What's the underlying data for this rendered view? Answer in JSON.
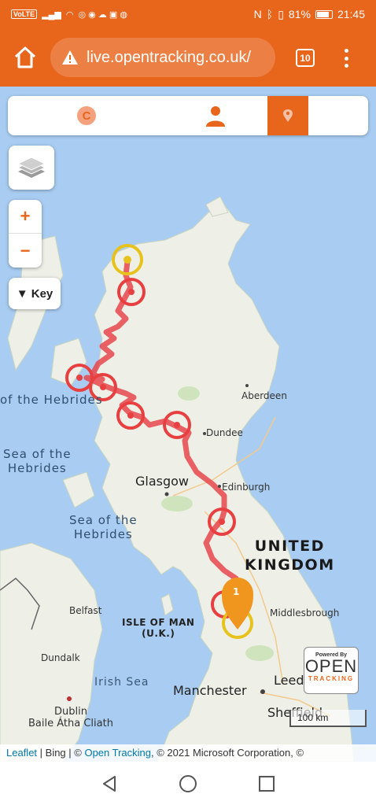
{
  "status_bar": {
    "volte": "VoLTE",
    "battery": "81%",
    "time": "21:45"
  },
  "browser": {
    "url": "live.opentracking.co.uk/",
    "tab_count": "10"
  },
  "panel": {
    "c_badge": "C"
  },
  "controls": {
    "zoom_in": "+",
    "zoom_out": "−",
    "key_label": "▼ Key"
  },
  "map_labels": {
    "hebrides_top": "of the Hebrides",
    "sea_hebrides_1": "Sea of the\nHebrides",
    "sea_hebrides_2": "Sea of the\nHebrides",
    "aberdeen": "Aberdeen",
    "dundee": "Dundee",
    "glasgow": "Glasgow",
    "edinburgh": "Edinburgh",
    "united_kingdom": "UNITED\nKINGDOM",
    "middlesbrough": "Middlesbrough",
    "belfast": "Belfast",
    "isle_of_man": "ISLE OF MAN\n(U.K.)",
    "dundalk": "Dundalk",
    "irish_sea": "Irish Sea",
    "manchester": "Manchester",
    "leeds": "Leed",
    "sheffield": "Sheffield",
    "dublin": "Dublin\nBaile Átha Cliath"
  },
  "marker": {
    "count": "1"
  },
  "branding": {
    "powered_by": "Powered By",
    "name": "OPEN",
    "sub": "TRACKING"
  },
  "scale": {
    "label": "100 km"
  },
  "attribution": {
    "leaflet": "Leaflet",
    "sep1": " | Bing | © ",
    "open_tracking": "Open Tracking",
    "rest": ", © 2021 Microsoft Corporation, ©"
  },
  "colors": {
    "accent": "#e8651c",
    "track": "#e8474c",
    "endpoint": "#e8c21c",
    "sea": "#a9cdf2",
    "land": "#eef0e8"
  }
}
